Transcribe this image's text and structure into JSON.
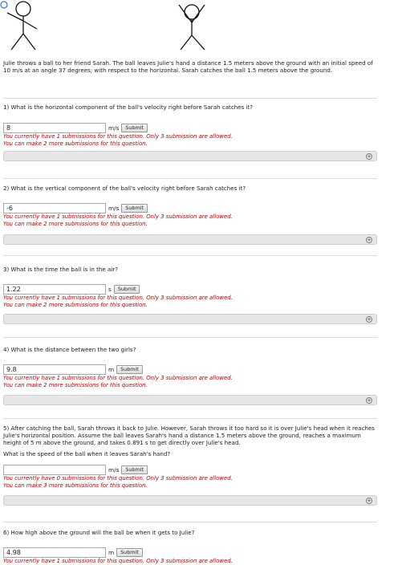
{
  "intro": "Julie throws a ball to her friend Sarah. The ball leaves Julie's hand a distance 1.5 meters above the ground with an initial speed of 10 m/s at an angle 37 degrees; with respect to the horizontal. Sarah catches the ball 1.5 meters above the ground.",
  "submit_label": "Submit",
  "questions": [
    {
      "text": "1) What is the horizontal component of the ball's velocity right before Sarah catches it?",
      "value": "8",
      "unit": "m/s",
      "msg1": "You currently have 1 submissions for this question. Only 3 submission are allowed.",
      "msg2": "You can make 2 more submissions for this question."
    },
    {
      "text": "2) What is the vertical component of the ball's velocity right before Sarah catches it?",
      "value": "-6",
      "unit": "m/s",
      "msg1": "You currently have 1 submissions for this question. Only 3 submission are allowed.",
      "msg2": "You can make 2 more submissions for this question."
    },
    {
      "text": "3) What is the time the ball is in the air?",
      "value": "1.22",
      "unit": "s",
      "msg1": "You currently have 1 submissions for this question. Only 3 submission are allowed.",
      "msg2": "You can make 2 more submissions for this question."
    },
    {
      "text": "4) What is the distance between the two girls?",
      "value": "9.8",
      "unit": "m",
      "msg1": "You currently have 1 submissions for this question. Only 3 submission are allowed.",
      "msg2": "You can make 2 more submissions for this question."
    },
    {
      "text": "5) After catching the ball, Sarah throws it back to Julie. However, Sarah throws it too hard so it is over Julie's head when it reaches Julie's horizontal position. Assume the ball leaves Sarah's hand a distance 1.5 meters above the ground, reaches a maximum height of 5 m above the ground, and takes 0.891 s to get directly over Julie's head.",
      "subtext": "What is the speed of the ball when it leaves Sarah's hand?",
      "value": "",
      "unit": "m/s",
      "msg1": "You currently have 0 submissions for this question. Only 3 submission are allowed.",
      "msg2": "You can make 3 more submissions for this question."
    },
    {
      "text": "6) How high above the ground will the ball be when it gets to Julie?",
      "value": "4.98",
      "unit": "m",
      "msg1": "You currently have 1 submissions for this question. Only 3 submission are allowed."
    }
  ],
  "colors": {
    "error": "#c00000",
    "bar": "#e6e6e6",
    "figure_circle": "#3a6fd8"
  },
  "icons": {
    "expand": "plus-circle-icon"
  }
}
